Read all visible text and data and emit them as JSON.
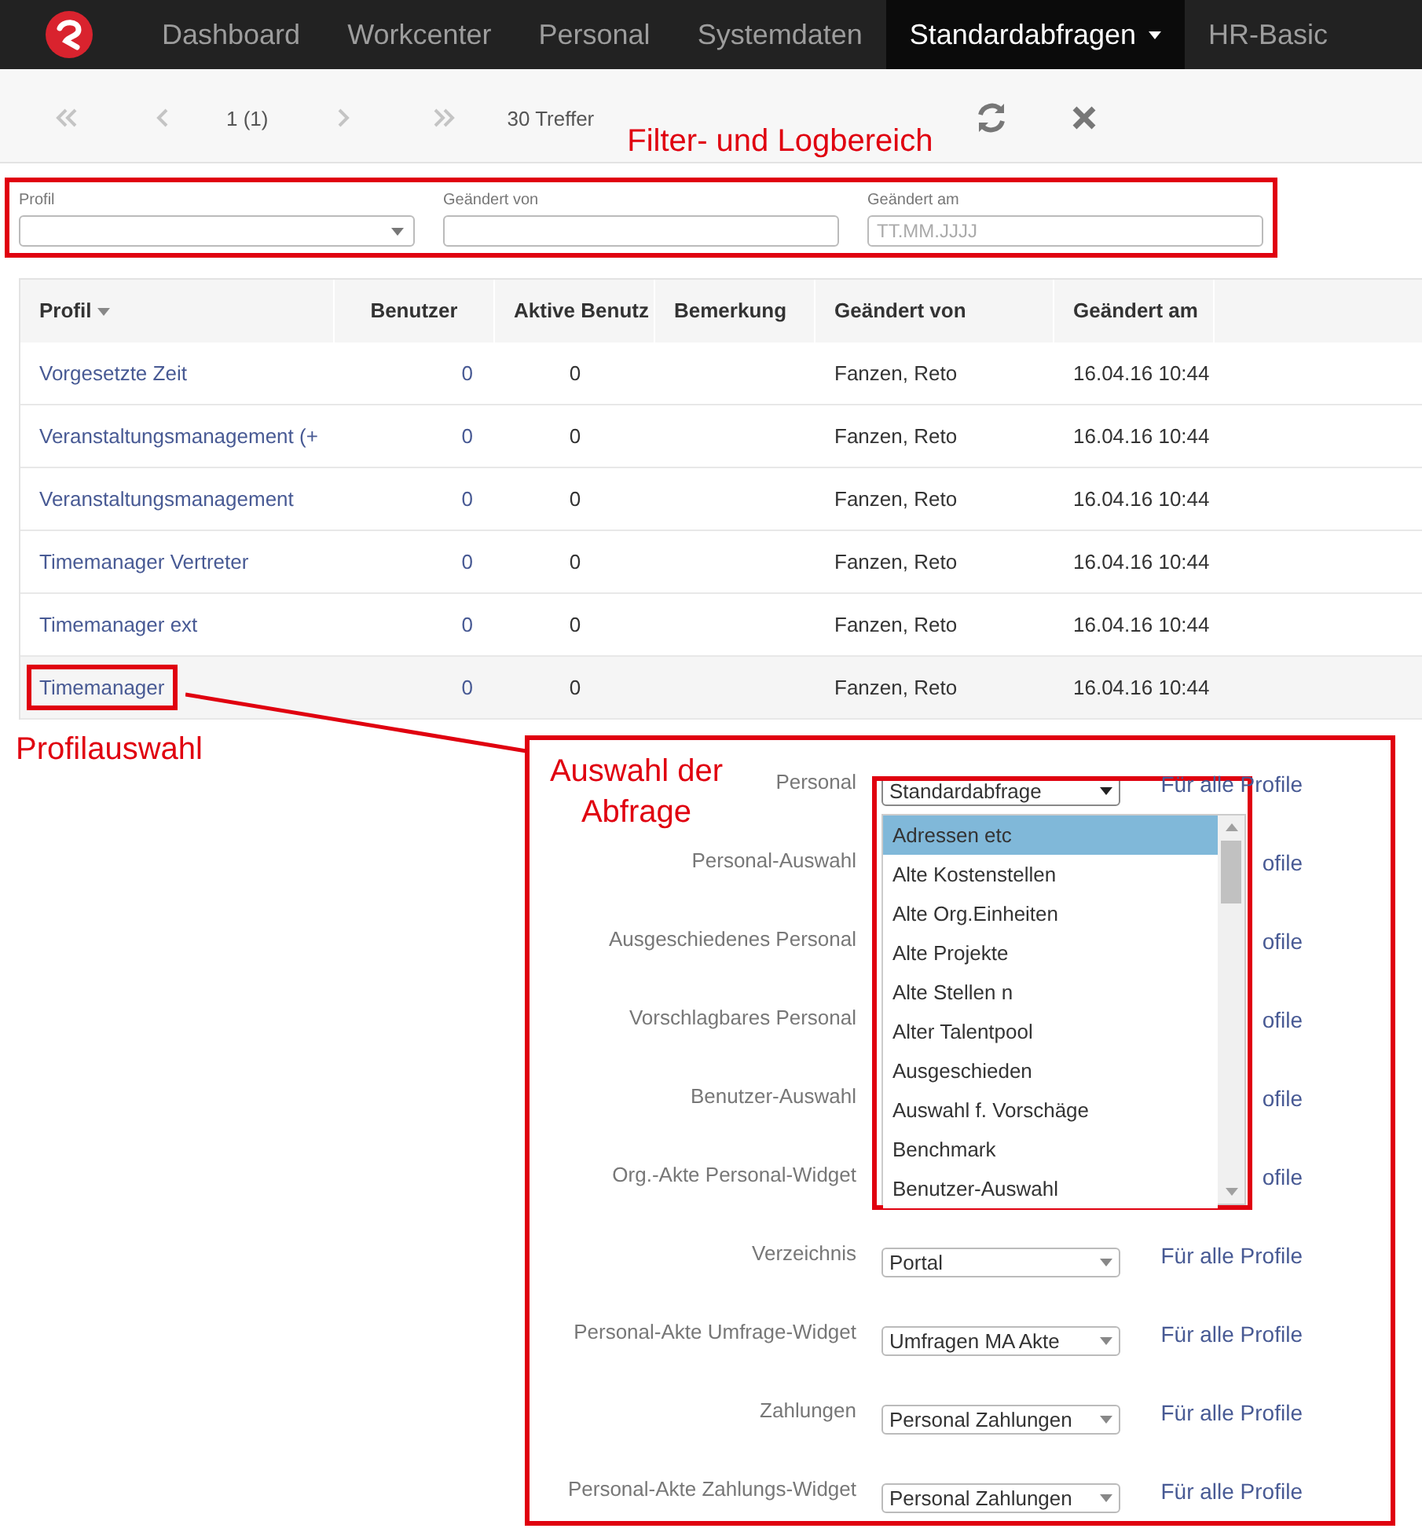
{
  "nav": {
    "items": [
      {
        "label": "Dashboard",
        "selected": false,
        "dropdown": false
      },
      {
        "label": "Workcenter",
        "selected": false,
        "dropdown": false
      },
      {
        "label": "Personal",
        "selected": false,
        "dropdown": false
      },
      {
        "label": "Systemdaten",
        "selected": false,
        "dropdown": false
      },
      {
        "label": "Standardabfragen",
        "selected": true,
        "dropdown": true
      },
      {
        "label": "HR-Basic",
        "selected": false,
        "dropdown": false
      }
    ]
  },
  "pager": {
    "page": "1 (1)",
    "hits": "30 Treffer"
  },
  "annotations": {
    "filter": "Filter- und Logbereich",
    "profile": "Profilauswahl",
    "query": "Auswahl der Abfrage"
  },
  "filters": [
    {
      "label": "Profil",
      "kind": "select"
    },
    {
      "label": "Geändert von",
      "kind": "text"
    },
    {
      "label": "Geändert am",
      "kind": "text",
      "placeholder": "TT.MM.JJJJ"
    }
  ],
  "table": {
    "columns": [
      {
        "label": "Profil",
        "sorted": true
      },
      {
        "label": "Benutzer",
        "sorted": false
      },
      {
        "label": "Aktive Benutz",
        "sorted": false
      },
      {
        "label": "Bemerkung",
        "sorted": false
      },
      {
        "label": "Geändert von",
        "sorted": false
      },
      {
        "label": "Geändert am",
        "sorted": false
      }
    ],
    "rows": [
      {
        "selected": false,
        "cells": [
          "Vorgesetzte Zeit",
          "0",
          "0",
          "",
          "Fanzen, Reto",
          "16.04.16 10:44"
        ]
      },
      {
        "selected": false,
        "cells": [
          "Veranstaltungsmanagement (+",
          "0",
          "0",
          "",
          "Fanzen, Reto",
          "16.04.16 10:44"
        ]
      },
      {
        "selected": false,
        "cells": [
          "Veranstaltungsmanagement",
          "0",
          "0",
          "",
          "Fanzen, Reto",
          "16.04.16 10:44"
        ]
      },
      {
        "selected": false,
        "cells": [
          "Timemanager Vertreter",
          "0",
          "0",
          "",
          "Fanzen, Reto",
          "16.04.16 10:44"
        ]
      },
      {
        "selected": false,
        "cells": [
          "Timemanager ext",
          "0",
          "0",
          "",
          "Fanzen, Reto",
          "16.04.16 10:44"
        ]
      },
      {
        "selected": true,
        "cells": [
          "Timemanager",
          "0",
          "0",
          "",
          "Fanzen, Reto",
          "16.04.16 10:44"
        ]
      }
    ]
  },
  "form": {
    "rows": [
      {
        "label": "Personal",
        "select": "Standardabfrage",
        "open": true,
        "link": "Für alle Profile"
      },
      {
        "label": "Personal-Auswahl",
        "link": "ofile"
      },
      {
        "label": "Ausgeschiedenes Personal",
        "link": "ofile"
      },
      {
        "label": "Vorschlagbares Personal",
        "link": "ofile"
      },
      {
        "label": "Benutzer-Auswahl",
        "link": "ofile"
      },
      {
        "label": "Org.-Akte Personal-Widget",
        "link": "ofile"
      },
      {
        "label": "Verzeichnis",
        "select": "Portal",
        "open": false,
        "link": "Für alle Profile"
      },
      {
        "label": "Personal-Akte Umfrage-Widget",
        "select": "Umfragen MA Akte",
        "open": false,
        "link": "Für alle Profile"
      },
      {
        "label": "Zahlungen",
        "select": "Personal Zahlungen",
        "open": false,
        "link": "Für alle Profile"
      },
      {
        "label": "Personal-Akte Zahlungs-Widget",
        "select": "Personal Zahlungen",
        "open": false,
        "link": "Für alle Profile"
      }
    ],
    "dropdown": {
      "options": [
        {
          "label": "Adressen etc",
          "selected": true
        },
        {
          "label": "Alte Kostenstellen",
          "selected": false
        },
        {
          "label": "Alte Org.Einheiten",
          "selected": false
        },
        {
          "label": "Alte Projekte",
          "selected": false
        },
        {
          "label": "Alte Stellen n",
          "selected": false
        },
        {
          "label": "Alter Talentpool",
          "selected": false
        },
        {
          "label": "Ausgeschieden",
          "selected": false
        },
        {
          "label": "Auswahl f. Vorschäge",
          "selected": false
        },
        {
          "label": "Benchmark",
          "selected": false
        },
        {
          "label": "Benutzer-Auswahl",
          "selected": false
        }
      ]
    }
  }
}
